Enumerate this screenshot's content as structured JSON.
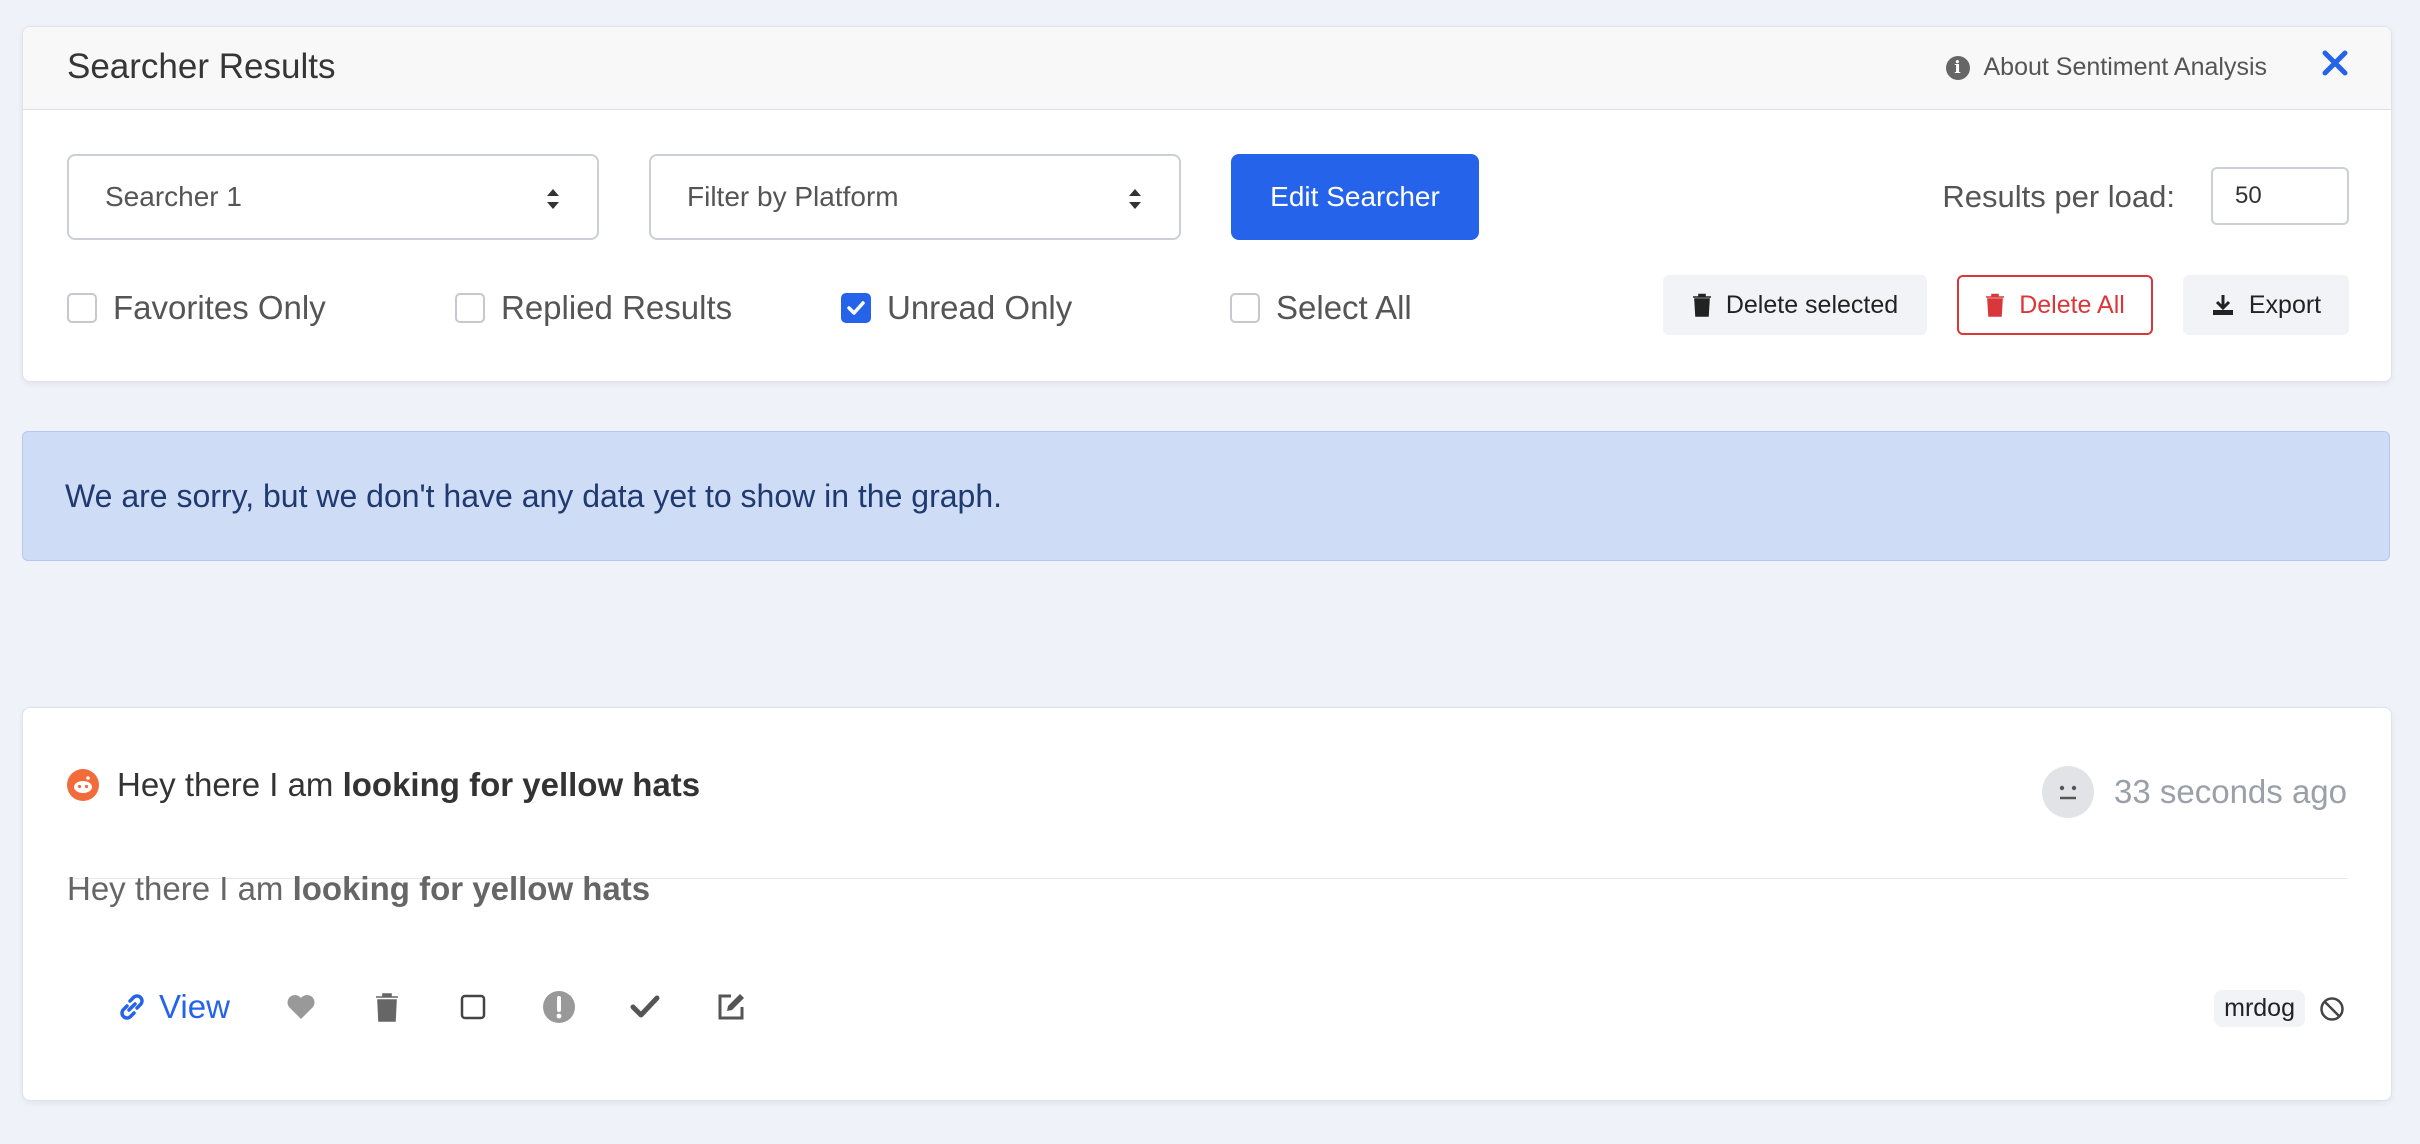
{
  "header": {
    "title": "Searcher Results",
    "about_label": "About Sentiment Analysis"
  },
  "filters": {
    "searcher_select": "Searcher 1",
    "platform_select": "Filter by Platform",
    "edit_button": "Edit Searcher",
    "results_per_load_label": "Results per load:",
    "results_per_load_value": "50"
  },
  "checkboxes": [
    {
      "label": "Favorites Only",
      "checked": false
    },
    {
      "label": "Replied Results",
      "checked": false
    },
    {
      "label": "Unread Only",
      "checked": true
    },
    {
      "label": "Select All",
      "checked": false
    }
  ],
  "actions": {
    "delete_selected": "Delete selected",
    "delete_all": "Delete All",
    "export": "Export"
  },
  "alert": {
    "message": "We are sorry, but we don't have any data yet to show in the graph."
  },
  "result": {
    "title_prefix": "Hey there I am ",
    "title_bold": "looking for yellow hats",
    "body_prefix": "Hey there I am ",
    "body_bold": "looking for yellow hats",
    "time": "33 seconds ago",
    "view_label": "View",
    "author": "mrdog",
    "platform_icon": "reddit-icon",
    "sentiment_icon": "neutral-face-icon"
  },
  "colors": {
    "primary": "#2563eb",
    "danger": "#d9383a",
    "alert_bg": "#cfdcf6",
    "reddit": "#f26b3a"
  }
}
